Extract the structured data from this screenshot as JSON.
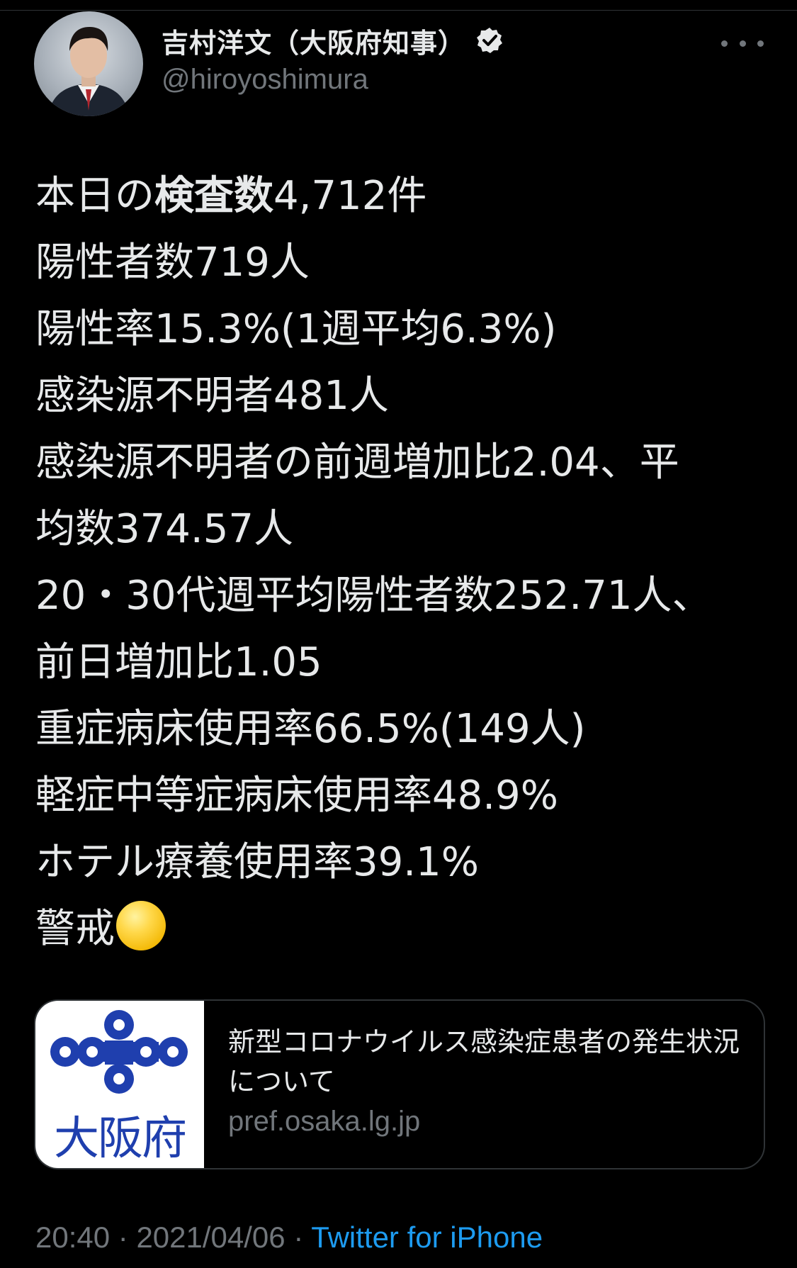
{
  "author": {
    "display_name": "吉村洋文（大阪府知事）",
    "handle": "@hiroyoshimura"
  },
  "tweet": {
    "line1_prefix": "本日の",
    "line1_bold": "検査数",
    "line1_suffix": "4,712件",
    "lines": [
      "陽性者数719人",
      "陽性率15.3%(1週平均6.3%)",
      "感染源不明者481人",
      "感染源不明者の前週増加比2.04、平",
      "均数374.57人",
      "20・30代週平均陽性者数252.71人、",
      "前日増加比1.05",
      "重症病床使用率66.5%(149人)",
      "軽症中等症病床使用率48.9%",
      "ホテル療養使用率39.1%"
    ],
    "last_line_text": "警戒",
    "last_line_emoji": "yellow-circle"
  },
  "link_card": {
    "thumbnail_text": "大阪府",
    "title": "新型コロナウイルス感染症患者の発生状況について",
    "domain": "pref.osaka.lg.jp"
  },
  "meta": {
    "time": "20:40",
    "separator": " · ",
    "date": "2021/04/06",
    "source": "Twitter for iPhone"
  },
  "colors": {
    "background": "#000000",
    "text": "#e7e9ea",
    "muted": "#71767b",
    "link": "#1d9bf0",
    "osaka_blue": "#1f3fae"
  }
}
